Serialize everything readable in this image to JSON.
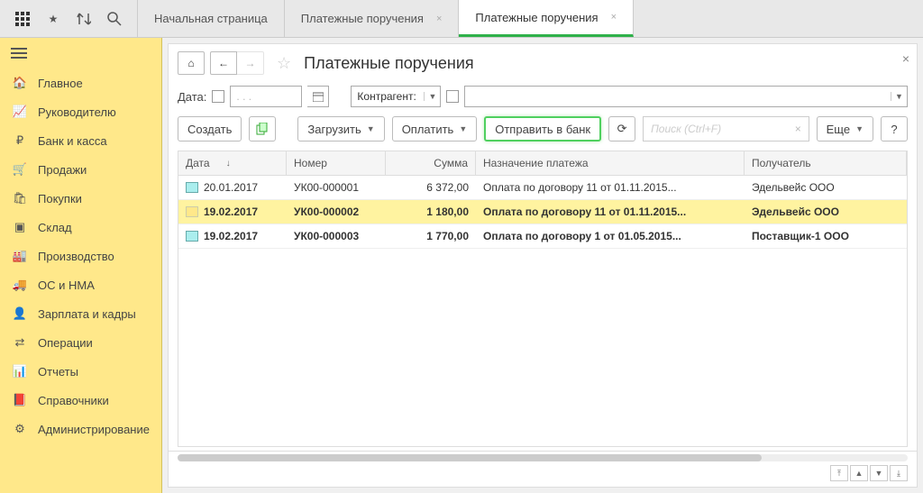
{
  "tabs": [
    {
      "label": "Начальная страница",
      "closable": false
    },
    {
      "label": "Платежные поручения",
      "closable": true
    },
    {
      "label": "Платежные поручения",
      "closable": true,
      "active": true
    }
  ],
  "sidebar": {
    "items": [
      {
        "label": "Главное",
        "icon": "home"
      },
      {
        "label": "Руководителю",
        "icon": "chart"
      },
      {
        "label": "Банк и касса",
        "icon": "ruble"
      },
      {
        "label": "Продажи",
        "icon": "cart"
      },
      {
        "label": "Покупки",
        "icon": "basket"
      },
      {
        "label": "Склад",
        "icon": "boxes"
      },
      {
        "label": "Производство",
        "icon": "factory"
      },
      {
        "label": "ОС и НМА",
        "icon": "truck"
      },
      {
        "label": "Зарплата и кадры",
        "icon": "person"
      },
      {
        "label": "Операции",
        "icon": "ops"
      },
      {
        "label": "Отчеты",
        "icon": "report"
      },
      {
        "label": "Справочники",
        "icon": "book"
      },
      {
        "label": "Администрирование",
        "icon": "gear"
      }
    ]
  },
  "page": {
    "title": "Платежные поручения",
    "filters": {
      "date_label": "Дата:",
      "date_placeholder": ". .     .",
      "counterparty_label": "Контрагент:"
    },
    "toolbar": {
      "create": "Создать",
      "load": "Загрузить",
      "pay": "Оплатить",
      "send_bank": "Отправить в банк",
      "search_placeholder": "Поиск (Ctrl+F)",
      "more": "Еще"
    },
    "columns": {
      "date": "Дата",
      "number": "Номер",
      "sum": "Сумма",
      "purpose": "Назначение платежа",
      "recipient": "Получатель"
    },
    "rows": [
      {
        "date": "20.01.2017",
        "number": "УК00-000001",
        "sum": "6 372,00",
        "purpose": "Оплата по договору 11 от 01.11.2015...",
        "recipient": "Эдельвейс ООО",
        "selected": false,
        "bold": false
      },
      {
        "date": "19.02.2017",
        "number": "УК00-000002",
        "sum": "1 180,00",
        "purpose": "Оплата по договору 11 от 01.11.2015...",
        "recipient": "Эдельвейс ООО",
        "selected": true,
        "bold": true
      },
      {
        "date": "19.02.2017",
        "number": "УК00-000003",
        "sum": "1 770,00",
        "purpose": "Оплата по договору 1 от 01.05.2015...",
        "recipient": "Поставщик-1 ООО",
        "selected": false,
        "bold": true
      }
    ]
  }
}
